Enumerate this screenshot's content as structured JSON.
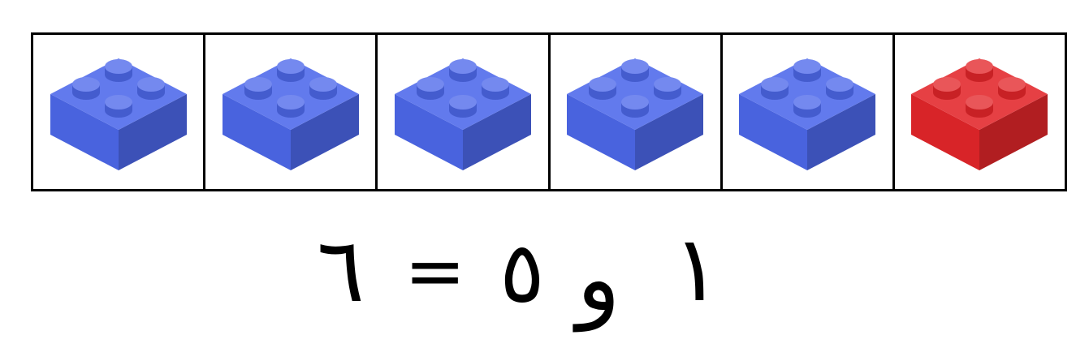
{
  "bricks": [
    {
      "color": "blue",
      "fill": "#4d68ea"
    },
    {
      "color": "blue",
      "fill": "#4d68ea"
    },
    {
      "color": "blue",
      "fill": "#4d68ea"
    },
    {
      "color": "blue",
      "fill": "#4d68ea"
    },
    {
      "color": "blue",
      "fill": "#4d68ea"
    },
    {
      "color": "red",
      "fill": "#e3262a"
    }
  ],
  "equation": {
    "result": "٦",
    "equals": "=",
    "addend_a": "٥",
    "conjunction": "و",
    "addend_b": "١"
  },
  "colors": {
    "blue": "#4d68ea",
    "red": "#e3262a",
    "border": "#000000"
  }
}
